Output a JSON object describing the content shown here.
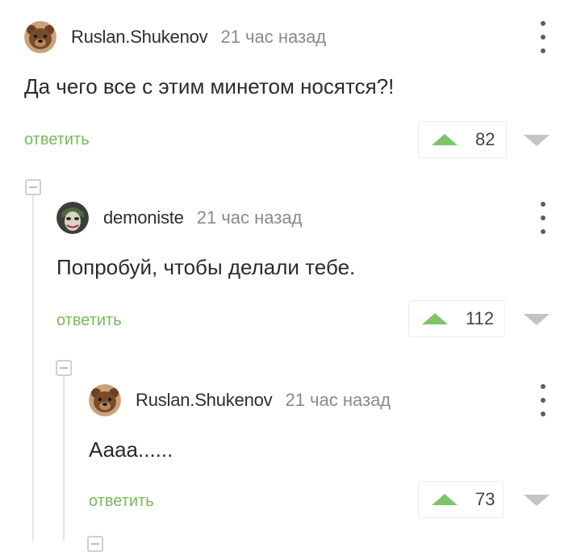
{
  "comments": [
    {
      "username": "Ruslan.Shukenov",
      "time": "21 час назад",
      "text": "Да чего все с этим минетом носятся?!",
      "reply_label": "ответить",
      "rating": "82",
      "avatar": "bear-avatar"
    },
    {
      "username": "demoniste",
      "time": "21 час назад",
      "text": "Попробуй, чтобы делали тебе.",
      "reply_label": "ответить",
      "rating": "112",
      "avatar": "joker-avatar"
    },
    {
      "username": "Ruslan.Shukenov",
      "time": "21 час назад",
      "text": "Аааа......",
      "reply_label": "ответить",
      "rating": "73",
      "avatar": "bear-avatar"
    }
  ],
  "colors": {
    "reply_link": "#78b95a",
    "upvote": "#7cc46a",
    "downvote": "#c3c3c3",
    "thread_line": "#e4e4e4"
  },
  "icons": [
    "kebab-menu-icon",
    "upvote-arrow-icon",
    "downvote-arrow-icon",
    "collapse-thread-icon"
  ]
}
